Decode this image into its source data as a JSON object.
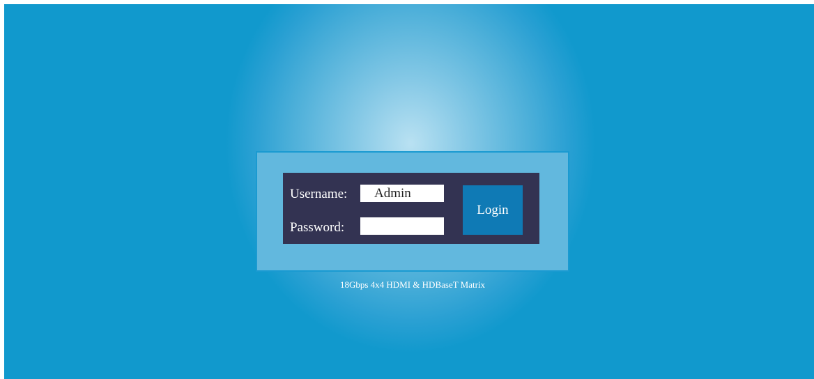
{
  "login": {
    "username_label": "Username:",
    "username_value": "Admin",
    "password_label": "Password:",
    "password_value": "",
    "login_button": "Login"
  },
  "footer": {
    "product_name": "18Gbps 4x4 HDMI & HDBaseT Matrix"
  },
  "colors": {
    "background": "#1199cd",
    "frame": "#62b8de",
    "panel": "#333352",
    "button": "#0f7ab5"
  }
}
